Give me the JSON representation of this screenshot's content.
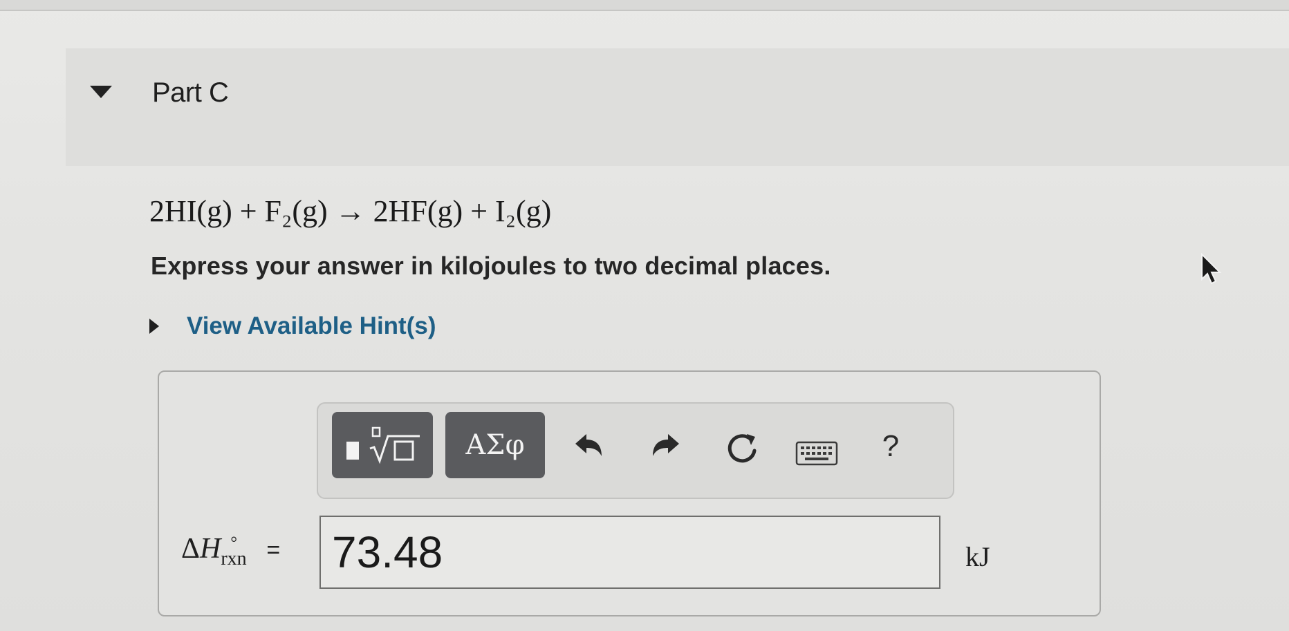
{
  "part": {
    "title": "Part C"
  },
  "question": {
    "equation": "2HI(g) + F₂(g) → 2HF(g) + I₂(g)",
    "instructions": "Express your answer in kilojoules to two decimal places.",
    "hint_link": "View Available Hint(s)"
  },
  "toolbar": {
    "symbols_label": "ΑΣφ",
    "help_label": "?",
    "icons": [
      "templates-icon",
      "undo-icon",
      "redo-icon",
      "reset-icon",
      "keyboard-icon",
      "help-icon"
    ]
  },
  "answer": {
    "delta_symbol": "Δ",
    "variable": "H",
    "superscript": "°",
    "subscript": "rxn",
    "equals": "=",
    "value": "73.48",
    "unit": "kJ"
  },
  "colors": {
    "hint_link": "#1e5f86",
    "dark_button": "#5a5b5e",
    "panel_border": "#a9a9a7"
  }
}
